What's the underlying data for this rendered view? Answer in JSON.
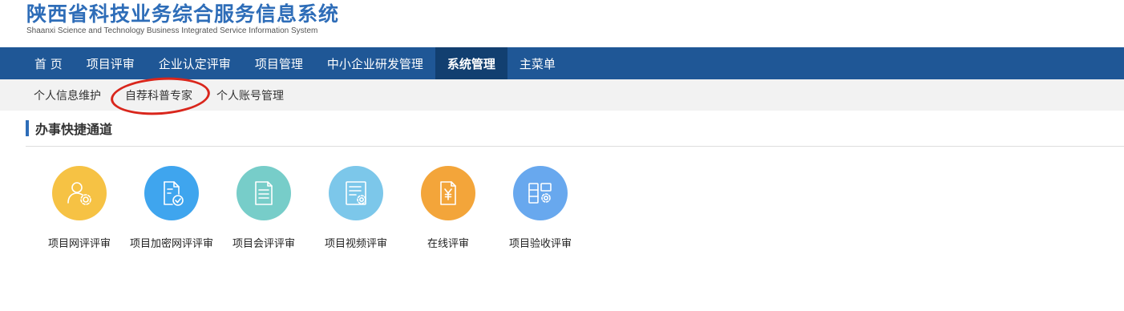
{
  "header": {
    "title": "陕西省科技业务综合服务信息系统",
    "subtitle": "Shaanxi Science and Technology Business Integrated Service Information System"
  },
  "mainnav": {
    "items": [
      {
        "label": "首 页"
      },
      {
        "label": "项目评审"
      },
      {
        "label": "企业认定评审"
      },
      {
        "label": "项目管理"
      },
      {
        "label": "中小企业研发管理"
      },
      {
        "label": "系统管理",
        "active": true
      },
      {
        "label": "主菜单"
      }
    ]
  },
  "subnav": {
    "items": [
      {
        "label": "个人信息维护"
      },
      {
        "label": "自荐科普专家",
        "highlighted": true
      },
      {
        "label": "个人账号管理"
      }
    ]
  },
  "section": {
    "title": "办事快捷通道"
  },
  "shortcuts": [
    {
      "label": "项目网评评审",
      "icon": "user-gear-icon",
      "color": "#f6c244"
    },
    {
      "label": "项目加密网评评审",
      "icon": "document-check-icon",
      "color": "#3fa5ee"
    },
    {
      "label": "项目会评评审",
      "icon": "document-lines-icon",
      "color": "#77cdc9"
    },
    {
      "label": "项目视频评审",
      "icon": "document-gear-icon",
      "color": "#7cc7ea"
    },
    {
      "label": "在线评审",
      "icon": "document-yen-icon",
      "color": "#f3a53a"
    },
    {
      "label": "项目验收评审",
      "icon": "grid-gear-icon",
      "color": "#68a8ee"
    }
  ],
  "colors": {
    "brand_blue": "#2e6db8",
    "nav_bg": "#1f5796",
    "nav_active_bg": "#123f70",
    "subnav_bg": "#f2f2f2",
    "annotation_red": "#d9261c"
  }
}
